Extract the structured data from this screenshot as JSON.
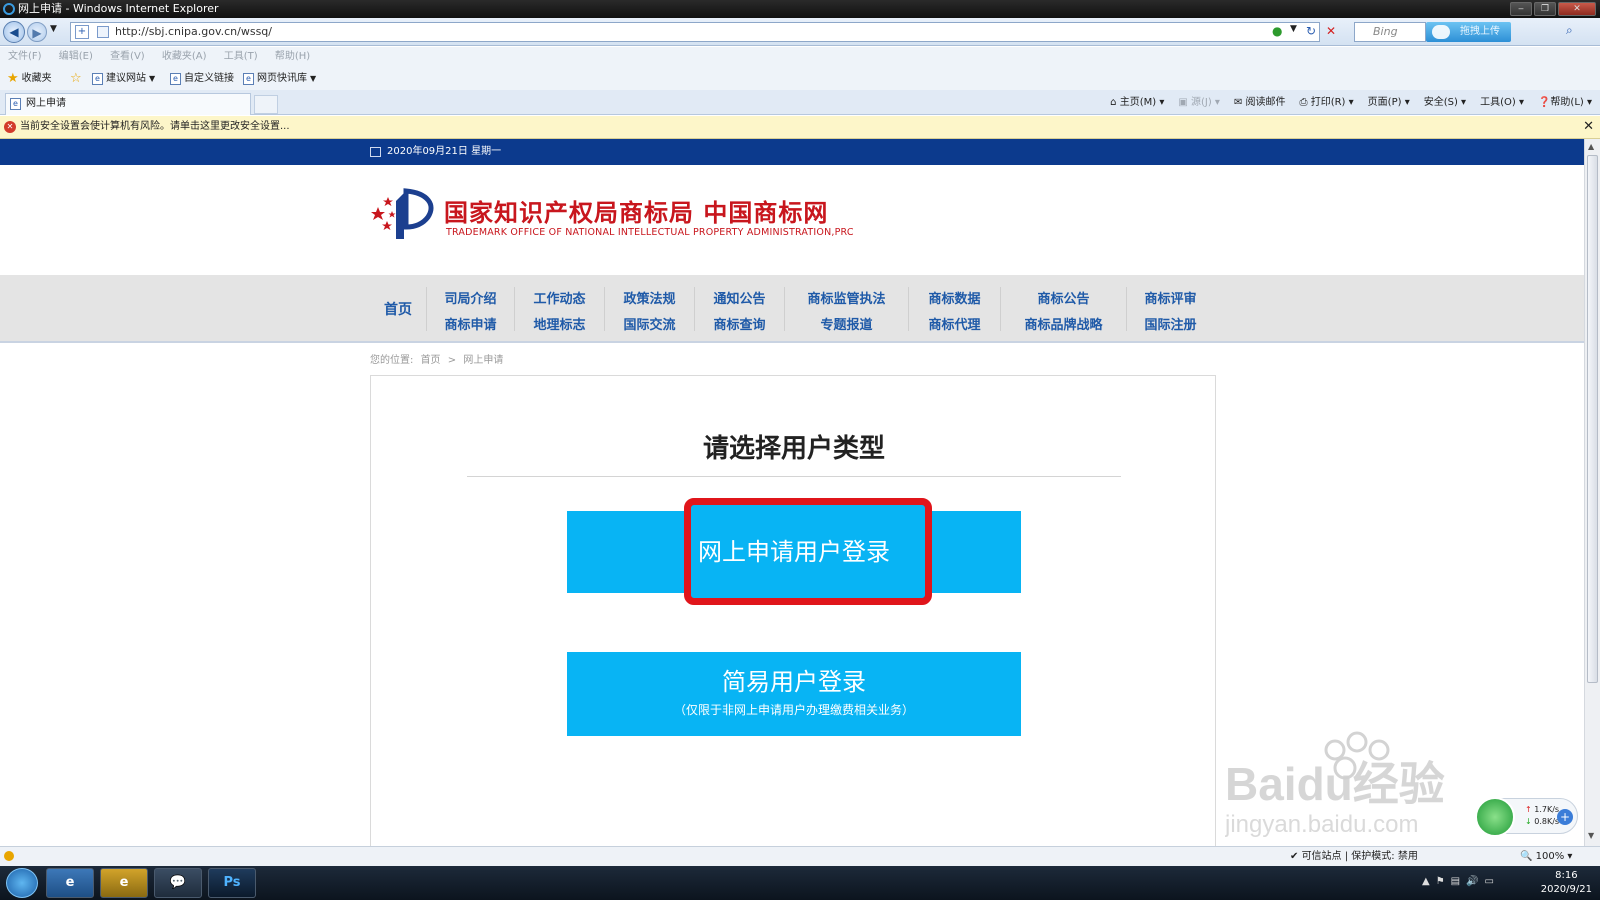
{
  "window": {
    "title": "网上申请 - Windows Internet Explorer"
  },
  "address": {
    "url": "http://sbj.cnipa.gov.cn/wssq/",
    "search_placeholder": "Bing",
    "upload_label": "拖拽上传"
  },
  "menubar": [
    "文件(F)",
    "编辑(E)",
    "查看(V)",
    "收藏夹(A)",
    "工具(T)",
    "帮助(H)"
  ],
  "favorites": {
    "label": "收藏夹",
    "items": [
      "建议网站",
      "自定义链接",
      "网页快讯库"
    ]
  },
  "tab": {
    "label": "网上申请"
  },
  "commandbar": [
    "主页(M)",
    "源(J)",
    "阅读邮件",
    "打印(R)",
    "页面(P)",
    "安全(S)",
    "工具(O)",
    "帮助(L)"
  ],
  "infobar": {
    "message": "当前安全设置会使计算机有风险。请单击这里更改安全设置..."
  },
  "page": {
    "date": "2020年09月21日 星期一",
    "site_title_cn": "国家知识产权局商标局 中国商标网",
    "site_title_en": "TRADEMARK OFFICE OF NATIONAL INTELLECTUAL PROPERTY ADMINISTRATION,PRC",
    "nav": {
      "home": "首页",
      "columns": [
        [
          "司局介绍",
          "商标申请"
        ],
        [
          "工作动态",
          "地理标志"
        ],
        [
          "政策法规",
          "国际交流"
        ],
        [
          "通知公告",
          "商标查询"
        ],
        [
          "商标监管执法",
          "专题报道"
        ],
        [
          "商标数据",
          "商标代理"
        ],
        [
          "商标公告",
          "商标品牌战略"
        ],
        [
          "商标评审",
          "国际注册"
        ]
      ]
    },
    "breadcrumb": {
      "prefix": "您的位置:",
      "home": "首页",
      "sep": ">",
      "current": "网上申请"
    },
    "panel": {
      "title": "请选择用户类型",
      "online_login": "网上申请用户登录",
      "simple_login": "简易用户登录",
      "simple_login_note": "（仅限于非网上申请用户办理缴费相关业务）"
    }
  },
  "statusbar": {
    "zone": "可信站点 | 保护模式: 禁用",
    "zoom": "100%"
  },
  "network": {
    "up": "1.7K/s",
    "down": "0.8K/s"
  },
  "taskbar": {
    "time": "8:16",
    "date": "2020/9/21",
    "ps_label": "Ps"
  },
  "watermark": {
    "brand": "Baidu经验",
    "url": "jingyan.baidu.com"
  },
  "colors": {
    "brand_red": "#c8161d",
    "nav_blue": "#1f5aa8",
    "button_blue": "#08b4f4",
    "highlight_red": "#e0151b",
    "top_strip": "#0c3a8d"
  }
}
